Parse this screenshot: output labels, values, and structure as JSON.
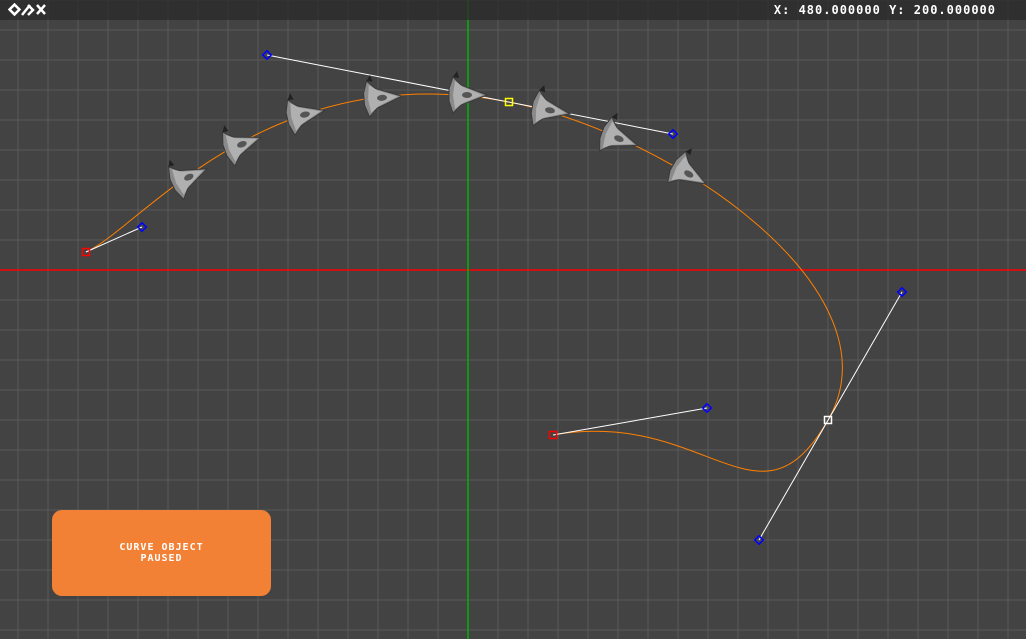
{
  "header": {
    "logo_text": "ORX",
    "coords_x_label": "X:",
    "coords_x_value": "480.000000",
    "coords_y_label": "Y:",
    "coords_y_value": "200.000000"
  },
  "status_panel": {
    "line1": "CURVE OBJECT",
    "line2": "PAUSED"
  },
  "colors": {
    "background": "#434343",
    "grid": "#5a5a5a",
    "x_axis": "#ff0000",
    "y_axis": "#00b400",
    "curve": "#ff8000",
    "handle_line": "#ffffff",
    "anchor_endpoint": "#ff0000",
    "anchor_selected": "#ffff00",
    "anchor_mid": "#ffffff",
    "control_point": "#0000ff",
    "panel": "#f28035"
  },
  "icons": {
    "logo": "orx-logo-icon",
    "sprite": "spaceship-icon"
  }
}
